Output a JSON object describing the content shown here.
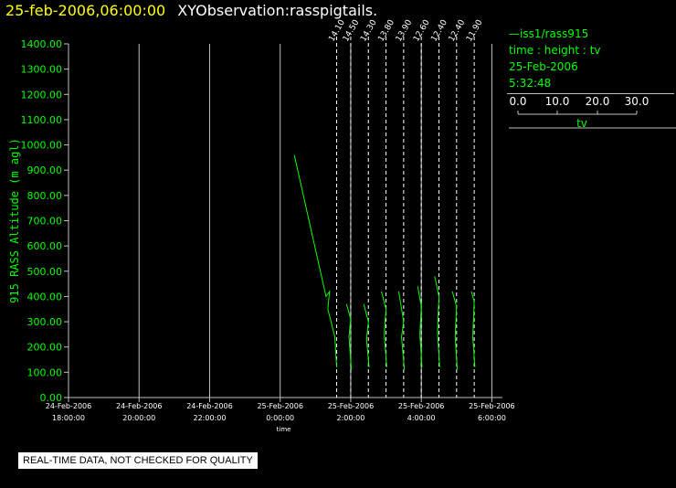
{
  "header": {
    "timestamp": "25-feb-2006,06:00:00",
    "observation": "XYObservation:rasspigtails."
  },
  "legend": {
    "series": "iss1/rass915",
    "axes": "time : height : tv",
    "date": "25-Feb-2006",
    "time": "5:32:48",
    "scale_ticks": [
      "0.0",
      "10.0",
      "20.0",
      "30.0"
    ],
    "scale_label": "tv"
  },
  "notice": "REAL-TIME DATA, NOT CHECKED FOR QUALITY",
  "colors": {
    "background": "#000000",
    "series": "#00ff00",
    "grid": "#c0c0c0",
    "header_time": "#ffff00"
  },
  "chart_data": {
    "type": "line",
    "xlabel": "time",
    "ylabel": "915 RASS Altitude (m agl)",
    "ylim": [
      0,
      1400
    ],
    "yticks": [
      "0.00",
      "100.00",
      "200.00",
      "300.00",
      "400.00",
      "500.00",
      "600.00",
      "700.00",
      "800.00",
      "900.00",
      "1000.00",
      "1100.00",
      "1200.00",
      "1300.00",
      "1400.00"
    ],
    "x_range_hours": [
      -6,
      6.3
    ],
    "xticks": [
      {
        "hour": -6,
        "date": "24-Feb-2006",
        "time": "18:00:00"
      },
      {
        "hour": -4,
        "date": "24-Feb-2006",
        "time": "20:00:00"
      },
      {
        "hour": -2,
        "date": "24-Feb-2006",
        "time": "22:00:00"
      },
      {
        "hour": 0,
        "date": "25-Feb-2006",
        "time": "0:00:00"
      },
      {
        "hour": 2,
        "date": "25-Feb-2006",
        "time": "2:00:00"
      },
      {
        "hour": 4,
        "date": "25-Feb-2006",
        "time": "4:00:00"
      },
      {
        "hour": 6,
        "date": "25-Feb-2006",
        "time": "6:00:00"
      }
    ],
    "profiles": [
      {
        "hour": 1.6,
        "label": "14.10",
        "points": [
          [
            0.4,
            960
          ],
          [
            1.3,
            400
          ],
          [
            1.4,
            420
          ],
          [
            1.35,
            350
          ],
          [
            1.55,
            240
          ],
          [
            1.6,
            120
          ]
        ]
      },
      {
        "hour": 2.0,
        "label": "14.50",
        "points": [
          [
            1.88,
            370
          ],
          [
            2.0,
            310
          ],
          [
            1.95,
            240
          ],
          [
            2.02,
            110
          ]
        ]
      },
      {
        "hour": 2.5,
        "label": "14.30",
        "points": [
          [
            2.37,
            370
          ],
          [
            2.5,
            300
          ],
          [
            2.45,
            230
          ],
          [
            2.52,
            120
          ]
        ]
      },
      {
        "hour": 3.0,
        "label": "13.80",
        "points": [
          [
            2.87,
            420
          ],
          [
            3.0,
            350
          ],
          [
            2.95,
            250
          ],
          [
            3.02,
            120
          ]
        ]
      },
      {
        "hour": 3.5,
        "label": "13.90",
        "points": [
          [
            3.36,
            420
          ],
          [
            3.5,
            300
          ],
          [
            3.44,
            240
          ],
          [
            3.52,
            110
          ]
        ]
      },
      {
        "hour": 4.0,
        "label": "12.60",
        "points": [
          [
            3.9,
            440
          ],
          [
            4.0,
            360
          ],
          [
            3.96,
            250
          ],
          [
            4.02,
            120
          ]
        ]
      },
      {
        "hour": 4.5,
        "label": "12.40",
        "points": [
          [
            4.38,
            480
          ],
          [
            4.5,
            400
          ],
          [
            4.46,
            260
          ],
          [
            4.52,
            120
          ]
        ]
      },
      {
        "hour": 5.0,
        "label": "12.40",
        "points": [
          [
            4.88,
            420
          ],
          [
            5.0,
            360
          ],
          [
            4.96,
            240
          ],
          [
            5.02,
            110
          ]
        ]
      },
      {
        "hour": 5.5,
        "label": "11.90",
        "points": [
          [
            5.42,
            420
          ],
          [
            5.5,
            380
          ],
          [
            5.46,
            240
          ],
          [
            5.52,
            120
          ]
        ]
      }
    ]
  }
}
